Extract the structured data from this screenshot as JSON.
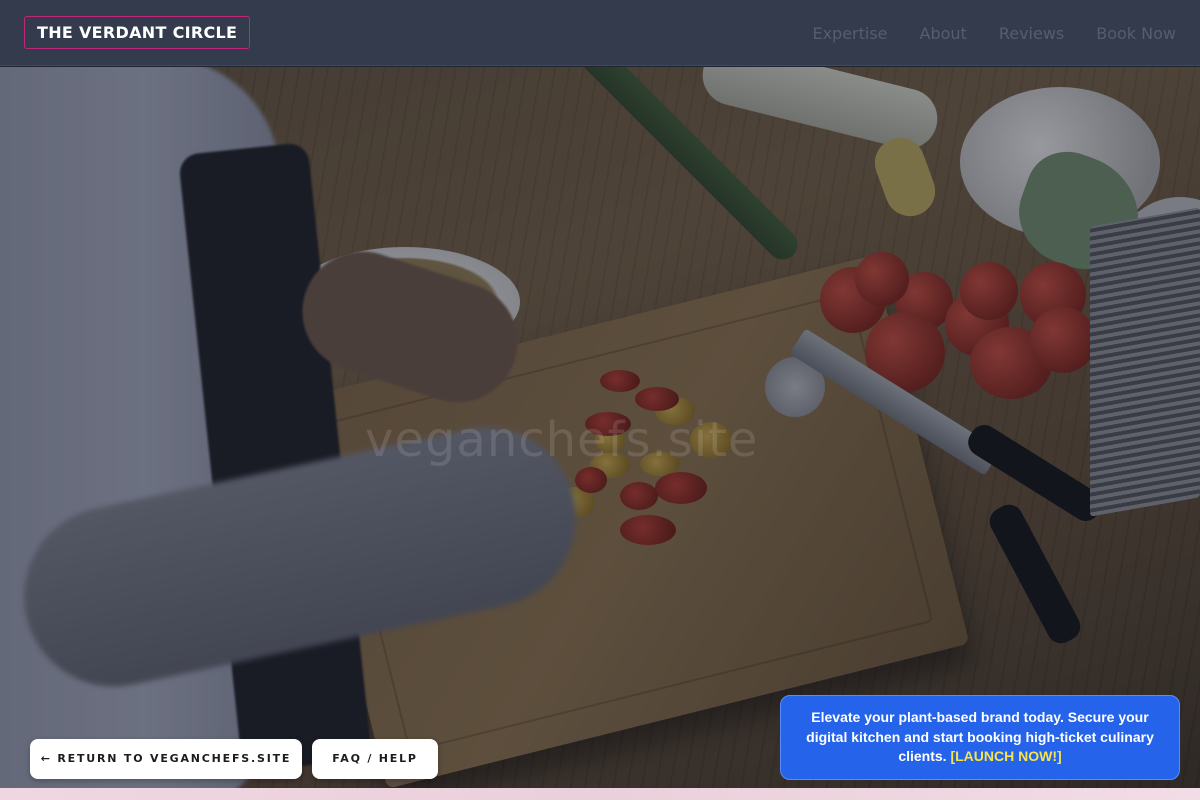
{
  "header": {
    "brand": "THE VERDANT CIRCLE",
    "nav": [
      {
        "label": "Expertise"
      },
      {
        "label": "About"
      },
      {
        "label": "Reviews"
      },
      {
        "label": "Book Now"
      }
    ]
  },
  "hero": {
    "watermark": "veganchefs.site"
  },
  "actions": {
    "return_label": "← RETURN TO VEGANCHEFS.SITE",
    "faq_label": "FAQ / HELP"
  },
  "promo": {
    "text": "Elevate your plant-based brand today. Secure your digital kitchen and start booking high-ticket culinary clients.",
    "cta": "[LAUNCH NOW!]"
  },
  "colors": {
    "header_bg": "#333b4d",
    "brand_border": "#c0267a",
    "nav_text": "#545e72",
    "promo_bg": "#2563eb",
    "promo_cta": "#f5e44a",
    "button_bg": "#ffffff"
  }
}
